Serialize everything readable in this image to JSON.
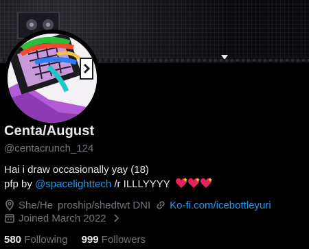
{
  "profile": {
    "display_name": "Centa/August",
    "handle": "@centacrunch_124",
    "bio_line1": "Hai i draw occasionally yay (18)",
    "bio_line2_prefix": "pfp by",
    "bio_mention": "@spacelighttech",
    "bio_line2_suffix": "/r ILLLYYYY",
    "pronouns": "She/He",
    "location_extra": "proship/shedtwt DNI",
    "website": "Ko-fi.com/icebottleyuri",
    "joined": "Joined March 2022",
    "following_count": "580",
    "following_label": "Following",
    "followers_count": "999",
    "followers_label": "Followers"
  },
  "icons": {
    "location": "location-pin-icon",
    "link": "link-icon",
    "calendar": "calendar-icon",
    "chevron": "chevron-right-icon",
    "hearts": "sparkling-heart-emoji"
  },
  "colors": {
    "background": "#000000",
    "primary_text": "#e7e9ea",
    "secondary_text": "#71767b",
    "link": "#1d9bf0",
    "heart": "#e0245e"
  }
}
